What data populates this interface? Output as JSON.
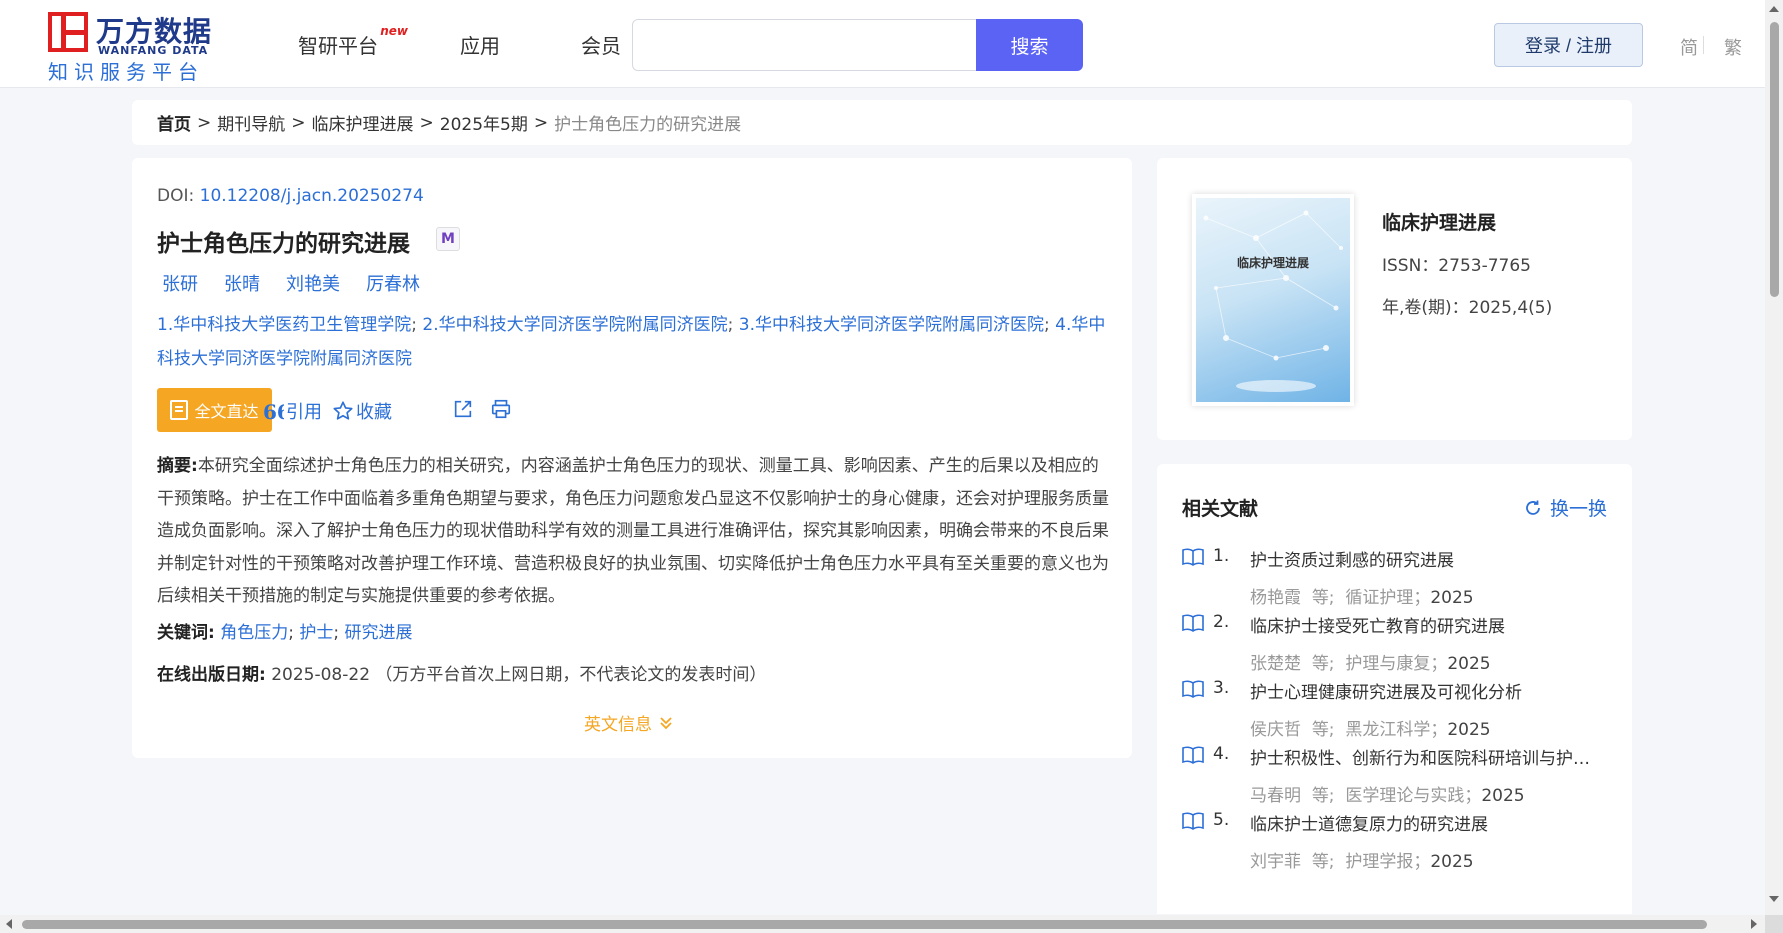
{
  "header": {
    "logo": {
      "cn": "万方数据",
      "en": "WANFANG DATA",
      "sub": "知识服务平台"
    },
    "nav": [
      {
        "label": "智研平台",
        "badge": "new"
      },
      {
        "label": "应用"
      },
      {
        "label": "会员"
      }
    ],
    "search": {
      "value": "",
      "placeholder": "",
      "button": "搜索"
    },
    "login": "登录 / 注册",
    "lang": {
      "simplified": "简",
      "traditional": "繁"
    }
  },
  "breadcrumb": {
    "items": [
      "首页",
      "期刊导航",
      "临床护理进展",
      "2025年5期"
    ],
    "current": "护士角色压力的研究进展",
    "separator": ">"
  },
  "article": {
    "doi_label": "DOI:",
    "doi": "10.12208/j.jacn.20250274",
    "title": "护士角色压力的研究进展",
    "badge": "M",
    "authors": [
      "张研",
      "张晴",
      "刘艳美",
      "厉春林"
    ],
    "affiliations": [
      "1.华中科技大学医药卫生管理学院",
      "2.华中科技大学同济医学院附属同济医院",
      "3.华中科技大学同济医学院附属同济医院",
      "4.华中科技大学同济医学院附属同济医院"
    ],
    "actions": {
      "fulltext": "全文直达",
      "cite": "引用",
      "favorite": "收藏"
    },
    "abstract_label": "摘要:",
    "abstract": "本研究全面综述护士角色压力的相关研究，内容涵盖护士角色压力的现状、测量工具、影响因素、产生的后果以及相应的干预策略。护士在工作中面临着多重角色期望与要求，角色压力问题愈发凸显这不仅影响护士的身心健康，还会对护理服务质量造成负面影响。深入了解护士角色压力的现状借助科学有效的测量工具进行准确评估，探究其影响因素，明确会带来的不良后果并制定针对性的干预策略对改善护理工作环境、营造积极良好的执业氛围、切实降低护士角色压力水平具有至关重要的意义也为后续相关干预措施的制定与实施提供重要的参考依据。",
    "keywords_label": "关键词:",
    "keywords": [
      "角色压力",
      "护士",
      "研究进展"
    ],
    "pubdate_label": "在线出版日期:",
    "pubdate": "2025-08-22",
    "pubdate_note": "（万方平台首次上网日期，不代表论文的发表时间）",
    "en_info": "英文信息"
  },
  "journal": {
    "cover_title": "临床护理进展",
    "name": "临床护理进展",
    "issn": "ISSN：2753-7765",
    "volume": "年,卷(期)：2025,4(5)"
  },
  "related": {
    "title": "相关文献",
    "refresh": "换一换",
    "items": [
      {
        "num": "1.",
        "title": "护士资质过剩感的研究进展",
        "author": "杨艳霞",
        "etal": "等;",
        "journal": "循证护理；",
        "year": "2025"
      },
      {
        "num": "2.",
        "title": "临床护士接受死亡教育的研究进展",
        "author": "张楚楚",
        "etal": "等;",
        "journal": "护理与康复；",
        "year": "2025"
      },
      {
        "num": "3.",
        "title": "护士心理健康研究进展及可视化分析",
        "author": "侯庆哲",
        "etal": "等;",
        "journal": "黑龙江科学；",
        "year": "2025"
      },
      {
        "num": "4.",
        "title": "护士积极性、创新行为和医院科研培训与护理科研能力的关系",
        "author": "马春明",
        "etal": "等;",
        "journal": "医学理论与实践；",
        "year": "2025"
      },
      {
        "num": "5.",
        "title": "临床护士道德复原力的研究进展",
        "author": "刘宇菲",
        "etal": "等;",
        "journal": "护理学报；",
        "year": "2025"
      }
    ]
  },
  "colors": {
    "accent": "#5b63f5",
    "link": "#2c6fd6",
    "orange": "#f5a623",
    "logo_red": "#e02020",
    "logo_blue": "#1f3a8a"
  }
}
